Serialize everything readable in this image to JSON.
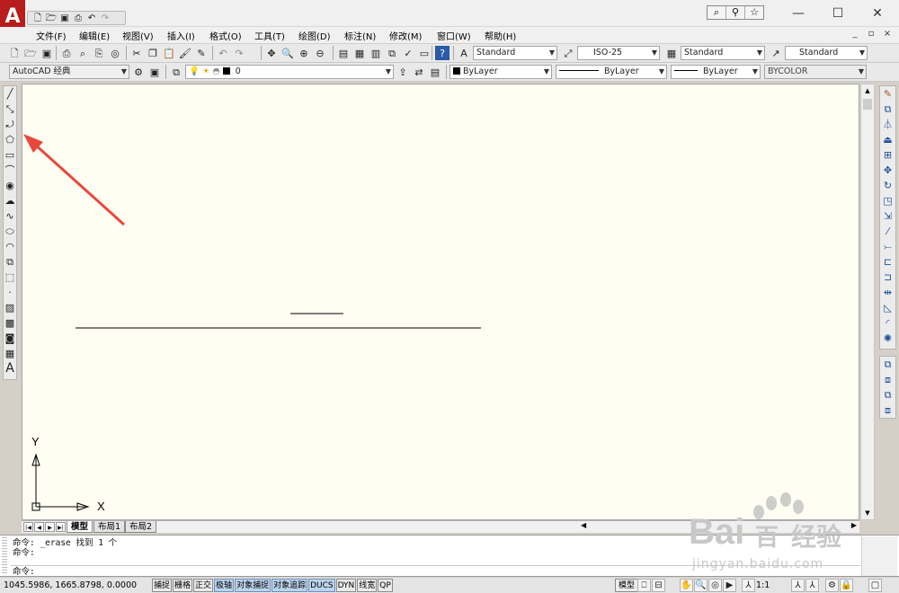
{
  "app": {
    "logo_letter": "A",
    "logo_dropdown": "▾",
    "quick_access": [
      "new-icon",
      "open-icon",
      "save-icon",
      "print-icon",
      "undo-icon",
      "redo-icon"
    ],
    "window_controls": {
      "minimize": "—",
      "maximize": "☐",
      "close": "✕"
    }
  },
  "menubar": {
    "items": [
      "文件(F)",
      "编辑(E)",
      "视图(V)",
      "插入(I)",
      "格式(O)",
      "工具(T)",
      "绘图(D)",
      "标注(N)",
      "修改(M)",
      "窗口(W)",
      "帮助(H)"
    ],
    "doc_controls": [
      "_",
      "▫",
      "×"
    ]
  },
  "toolbar_standard": {
    "text_style": "Standard",
    "dim_style": "ISO-25",
    "table_style": "Standard",
    "mleader_style": "Standard"
  },
  "toolbar_layers": {
    "workspace": "AutoCAD 经典",
    "layer_name": "0",
    "color": "ByLayer",
    "linetype": "ByLayer",
    "lineweight": "ByLayer",
    "plotstyle": "BYCOLOR"
  },
  "drawing": {
    "ucs_x_label": "X",
    "ucs_y_label": "Y"
  },
  "layout_tabs": {
    "nav_buttons": [
      "|◀",
      "◀",
      "▶",
      "▶|"
    ],
    "tabs": [
      "模型",
      "布局1",
      "布局2"
    ]
  },
  "command": {
    "lines": [
      "命令: _erase 找到 1 个",
      "命令:"
    ],
    "prompt": "命令:"
  },
  "status": {
    "coords": "1045.5986, 1665.8798, 0.0000",
    "toggles": [
      {
        "label": "捕捉",
        "on": false
      },
      {
        "label": "栅格",
        "on": false
      },
      {
        "label": "正交",
        "on": false
      },
      {
        "label": "极轴",
        "on": true
      },
      {
        "label": "对象捕捉",
        "on": true
      },
      {
        "label": "对象追踪",
        "on": true
      },
      {
        "label": "DUCS",
        "on": true
      },
      {
        "label": "DYN",
        "on": false
      },
      {
        "label": "线宽",
        "on": false
      },
      {
        "label": "QP",
        "on": false
      }
    ],
    "model_label": "模型",
    "scale": "1:1"
  },
  "watermark": {
    "brand": "Bai",
    "brand_tail": "百",
    "brand_cn": "经验",
    "url": "jingyan.baidu.com"
  },
  "colors": {
    "canvas": "#fffef3",
    "annotation_arrow": "#e8473c",
    "logo": "#b81c1c",
    "toggle_on": "#bcd3ec"
  }
}
